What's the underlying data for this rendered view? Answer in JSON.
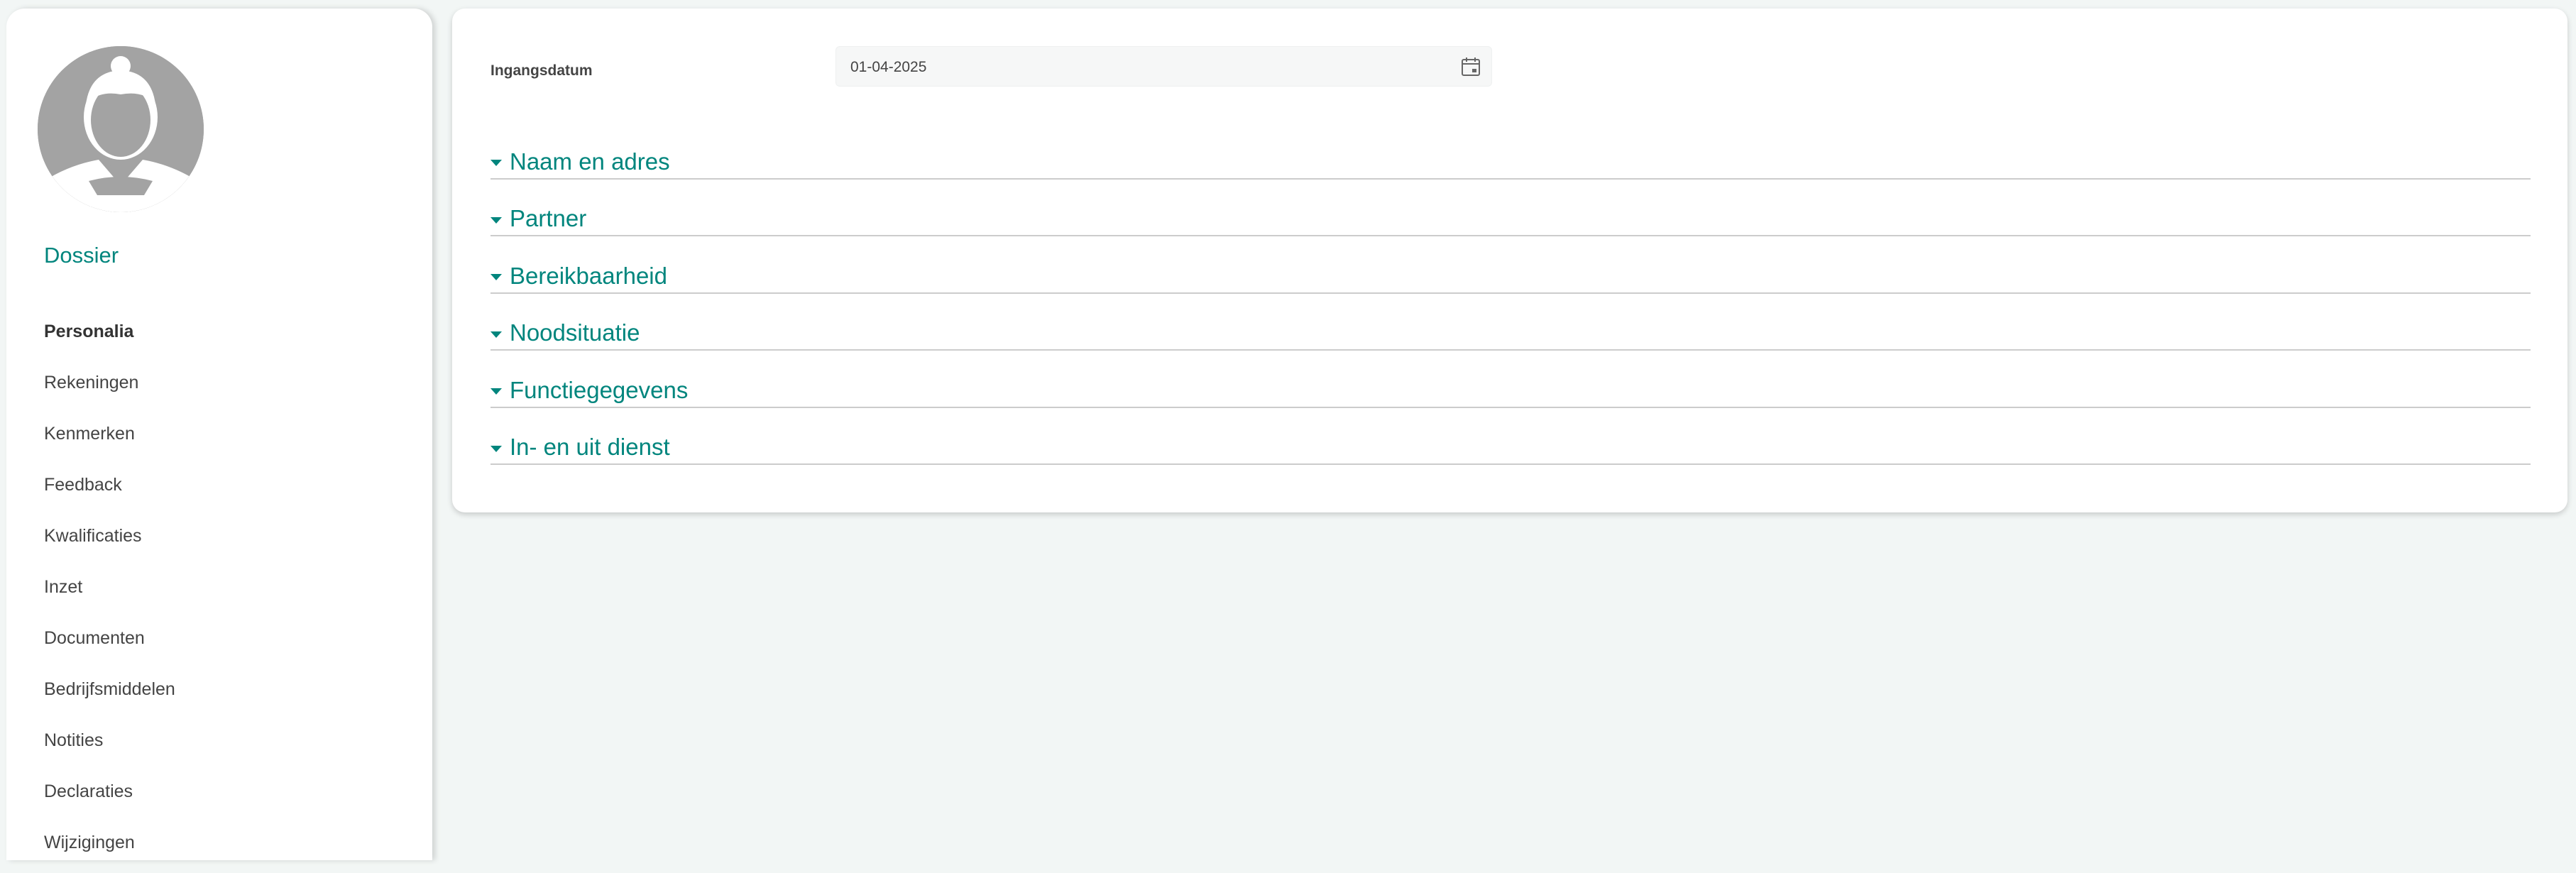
{
  "sidebar": {
    "title": "Dossier",
    "items": [
      {
        "label": "Personalia",
        "active": true
      },
      {
        "label": "Rekeningen"
      },
      {
        "label": "Kenmerken"
      },
      {
        "label": "Feedback"
      },
      {
        "label": "Kwalificaties"
      },
      {
        "label": "Inzet"
      },
      {
        "label": "Documenten"
      },
      {
        "label": "Bedrijfsmiddelen"
      },
      {
        "label": "Notities"
      },
      {
        "label": "Declaraties"
      },
      {
        "label": "Wijzigingen"
      }
    ]
  },
  "main": {
    "start_date": {
      "label": "Ingangsdatum",
      "value": "01-04-2025",
      "icon": "calendar-icon"
    },
    "sections": [
      {
        "title": "Naam en adres"
      },
      {
        "title": "Partner"
      },
      {
        "title": "Bereikbaarheid"
      },
      {
        "title": "Noodsituatie"
      },
      {
        "title": "Functiegegevens"
      },
      {
        "title": "In- en uit dienst"
      }
    ]
  },
  "colors": {
    "accent": "#00857d",
    "background": "#f2f6f5",
    "avatar": "#a3a3a3"
  }
}
